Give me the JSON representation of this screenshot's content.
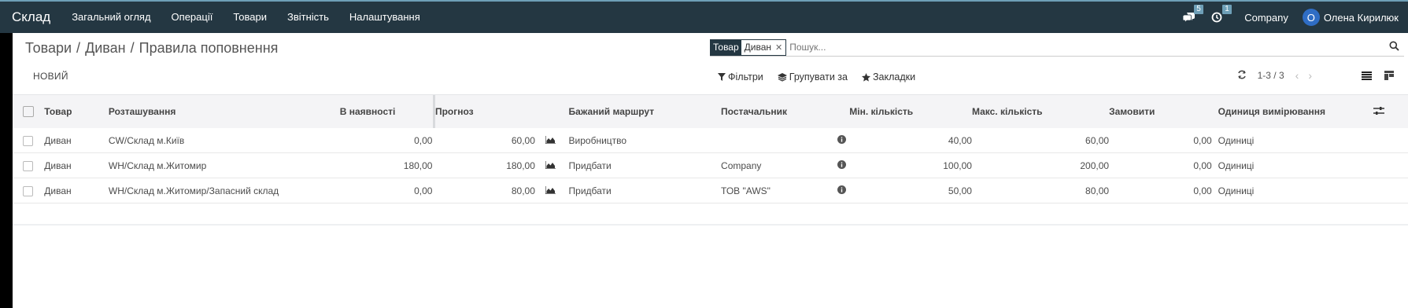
{
  "app": {
    "name": "Склад"
  },
  "nav": {
    "menu": [
      "Загальний огляд",
      "Операції",
      "Товари",
      "Звітність",
      "Налаштування"
    ],
    "messages_count": "5",
    "activity_count": "1",
    "company": "Company",
    "user_initial": "О",
    "user_name": "Олена Кирилюк"
  },
  "breadcrumb": [
    "Товари",
    "Диван",
    "Правила поповнення"
  ],
  "search": {
    "facet_label": "Товар",
    "facet_value": "Диван",
    "placeholder": "Пошук..."
  },
  "toolbar": {
    "new_label": "НОВИЙ",
    "filters_label": "Фільтри",
    "groupby_label": "Групувати за",
    "favorites_label": "Закладки",
    "pager_value": "1-3 / 3"
  },
  "table": {
    "headers": [
      "Товар",
      "Розташування",
      "В наявності",
      "Прогноз",
      "Бажаний маршрут",
      "Постачальник",
      "Мін. кількість",
      "Макс. кількість",
      "Замовити",
      "Одиниця вимірювання"
    ],
    "rows": [
      {
        "product": "Диван",
        "location": "CW/Склад м.Київ",
        "on_hand": "0,00",
        "forecast": "60,00",
        "route": "Виробництво",
        "vendor": "",
        "min": "40,00",
        "max": "60,00",
        "order": "0,00",
        "uom": "Одиниці"
      },
      {
        "product": "Диван",
        "location": "WH/Склад м.Житомир",
        "on_hand": "180,00",
        "forecast": "180,00",
        "route": "Придбати",
        "vendor": "Company",
        "min": "100,00",
        "max": "200,00",
        "order": "0,00",
        "uom": "Одиниці"
      },
      {
        "product": "Диван",
        "location": "WH/Склад м.Житомир/Запасний склад",
        "on_hand": "0,00",
        "forecast": "80,00",
        "route": "Придбати",
        "vendor": "ТОВ \"AWS\"",
        "min": "50,00",
        "max": "80,00",
        "order": "0,00",
        "uom": "Одиниці"
      }
    ]
  },
  "colors": {
    "navbar": "#243742",
    "accent": "#6e9fb7",
    "avatar": "#2f6dc4"
  }
}
